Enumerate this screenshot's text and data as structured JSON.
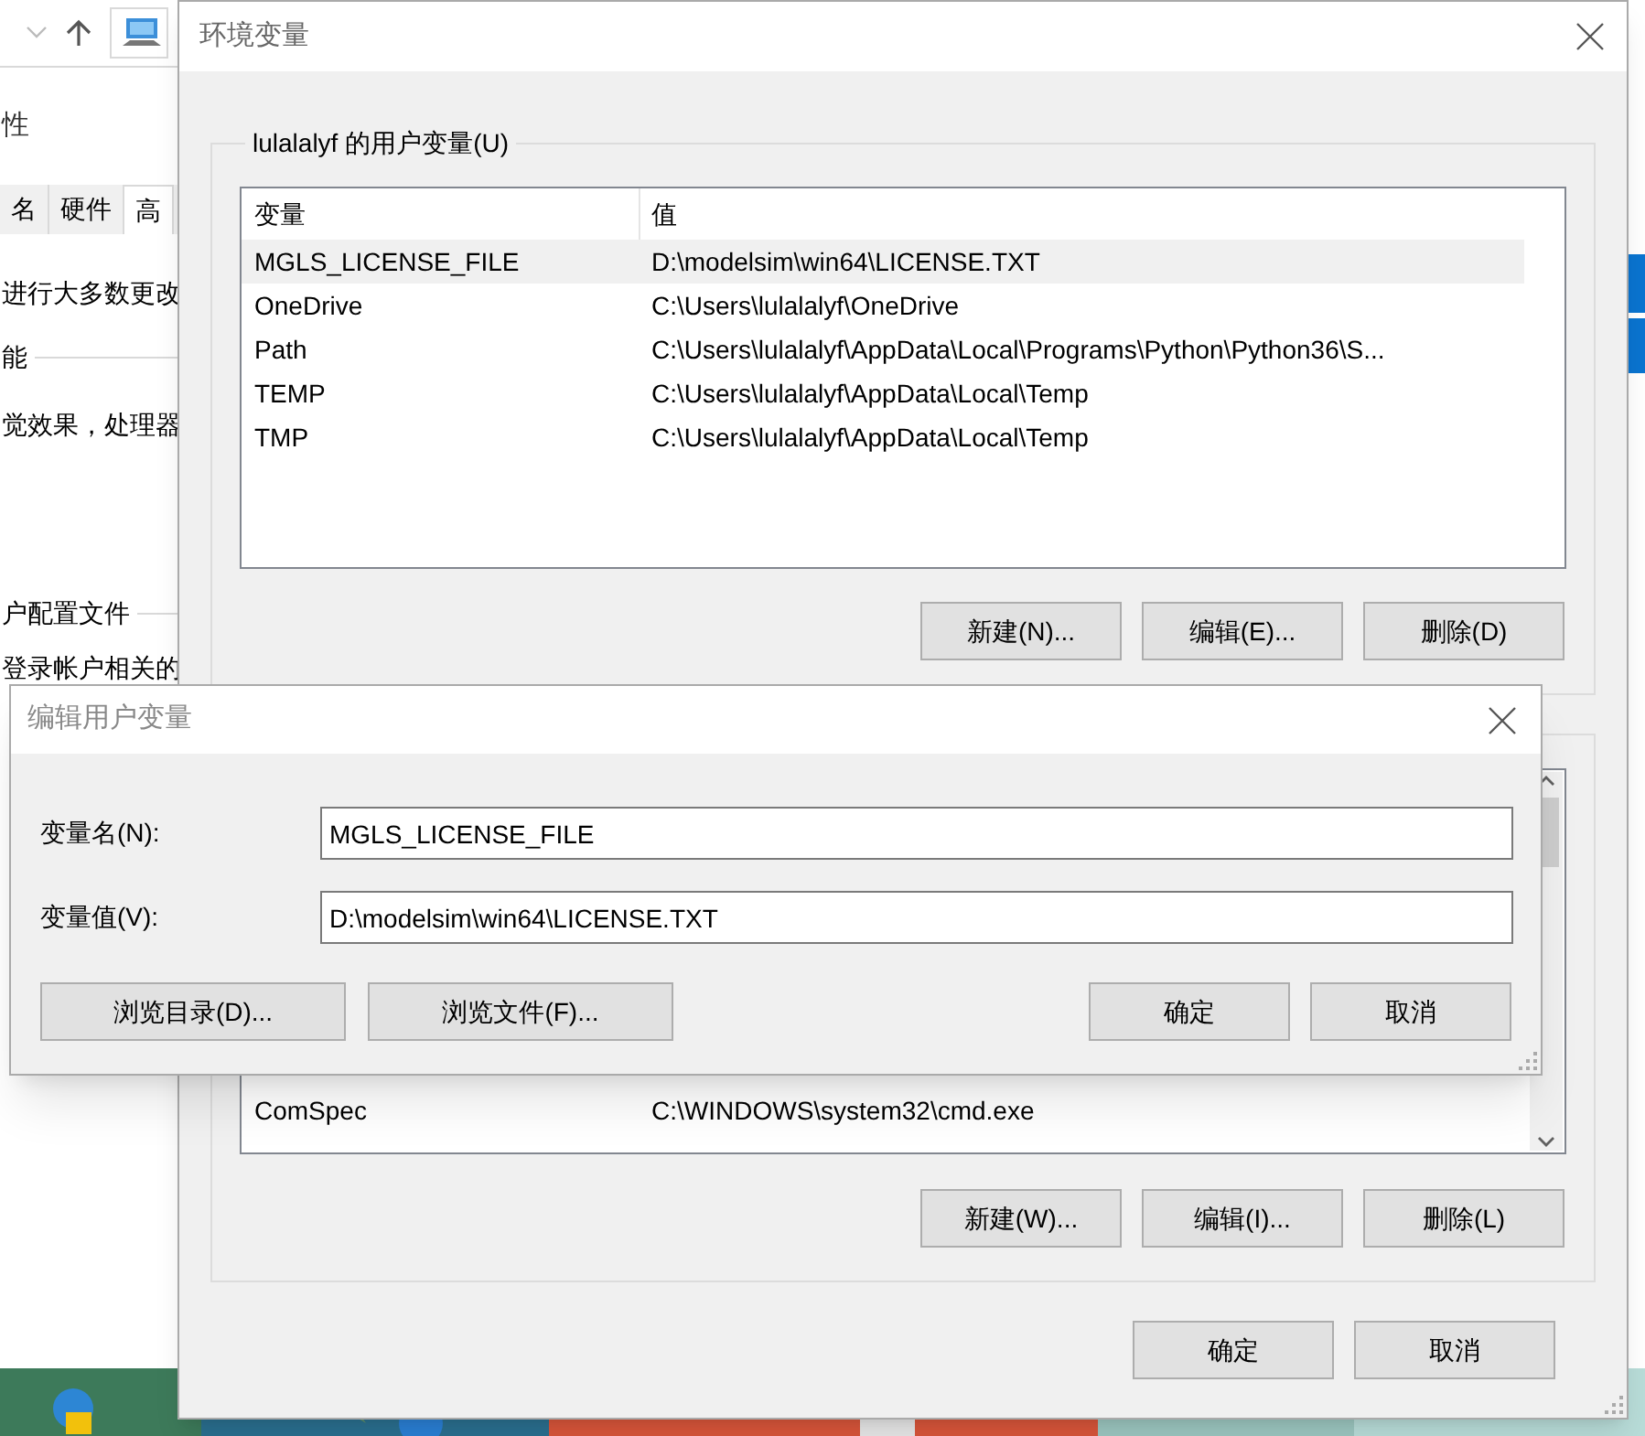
{
  "background_window": {
    "title": "性",
    "tabs": [
      {
        "label": "名",
        "selected": false
      },
      {
        "label": "硬件",
        "selected": false
      },
      {
        "label": "高",
        "selected": true
      }
    ],
    "texts": [
      {
        "kind": "text",
        "text": "进行大多数更改"
      },
      {
        "kind": "heading",
        "text": "能"
      },
      {
        "kind": "text",
        "text": "觉效果，处理器"
      },
      {
        "kind": "heading",
        "text": "户配置文件"
      },
      {
        "kind": "text",
        "text": "登录帐户相关的"
      }
    ]
  },
  "env_window": {
    "title": "环境变量",
    "user_group": {
      "legend": "lulalalyf 的用户变量(U)",
      "columns": [
        "变量",
        "值"
      ],
      "rows": [
        {
          "name": "MGLS_LICENSE_FILE",
          "value": "D:\\modelsim\\win64\\LICENSE.TXT",
          "selected": true
        },
        {
          "name": "OneDrive",
          "value": "C:\\Users\\lulalalyf\\OneDrive",
          "selected": false
        },
        {
          "name": "Path",
          "value": "C:\\Users\\lulalalyf\\AppData\\Local\\Programs\\Python\\Python36\\S...",
          "selected": false
        },
        {
          "name": "TEMP",
          "value": "C:\\Users\\lulalalyf\\AppData\\Local\\Temp",
          "selected": false
        },
        {
          "name": "TMP",
          "value": "C:\\Users\\lulalalyf\\AppData\\Local\\Temp",
          "selected": false
        }
      ],
      "buttons": [
        "新建(N)...",
        "编辑(E)...",
        "删除(D)"
      ]
    },
    "system_group": {
      "rows": [
        {
          "name": "ComSpec",
          "value": "C:\\WINDOWS\\system32\\cmd.exe",
          "selected": false
        }
      ],
      "buttons": [
        "新建(W)...",
        "编辑(I)...",
        "删除(L)"
      ]
    },
    "buttons": [
      "确定",
      "取消"
    ]
  },
  "edit_dialog": {
    "title": "编辑用户变量",
    "fields": [
      {
        "label": "变量名(N):",
        "value": "MGLS_LICENSE_FILE"
      },
      {
        "label": "变量值(V):",
        "value": "D:\\modelsim\\win64\\LICENSE.TXT"
      }
    ],
    "left_buttons": [
      "浏览目录(D)...",
      "浏览文件(F)..."
    ],
    "right_buttons": [
      "确定",
      "取消"
    ]
  }
}
